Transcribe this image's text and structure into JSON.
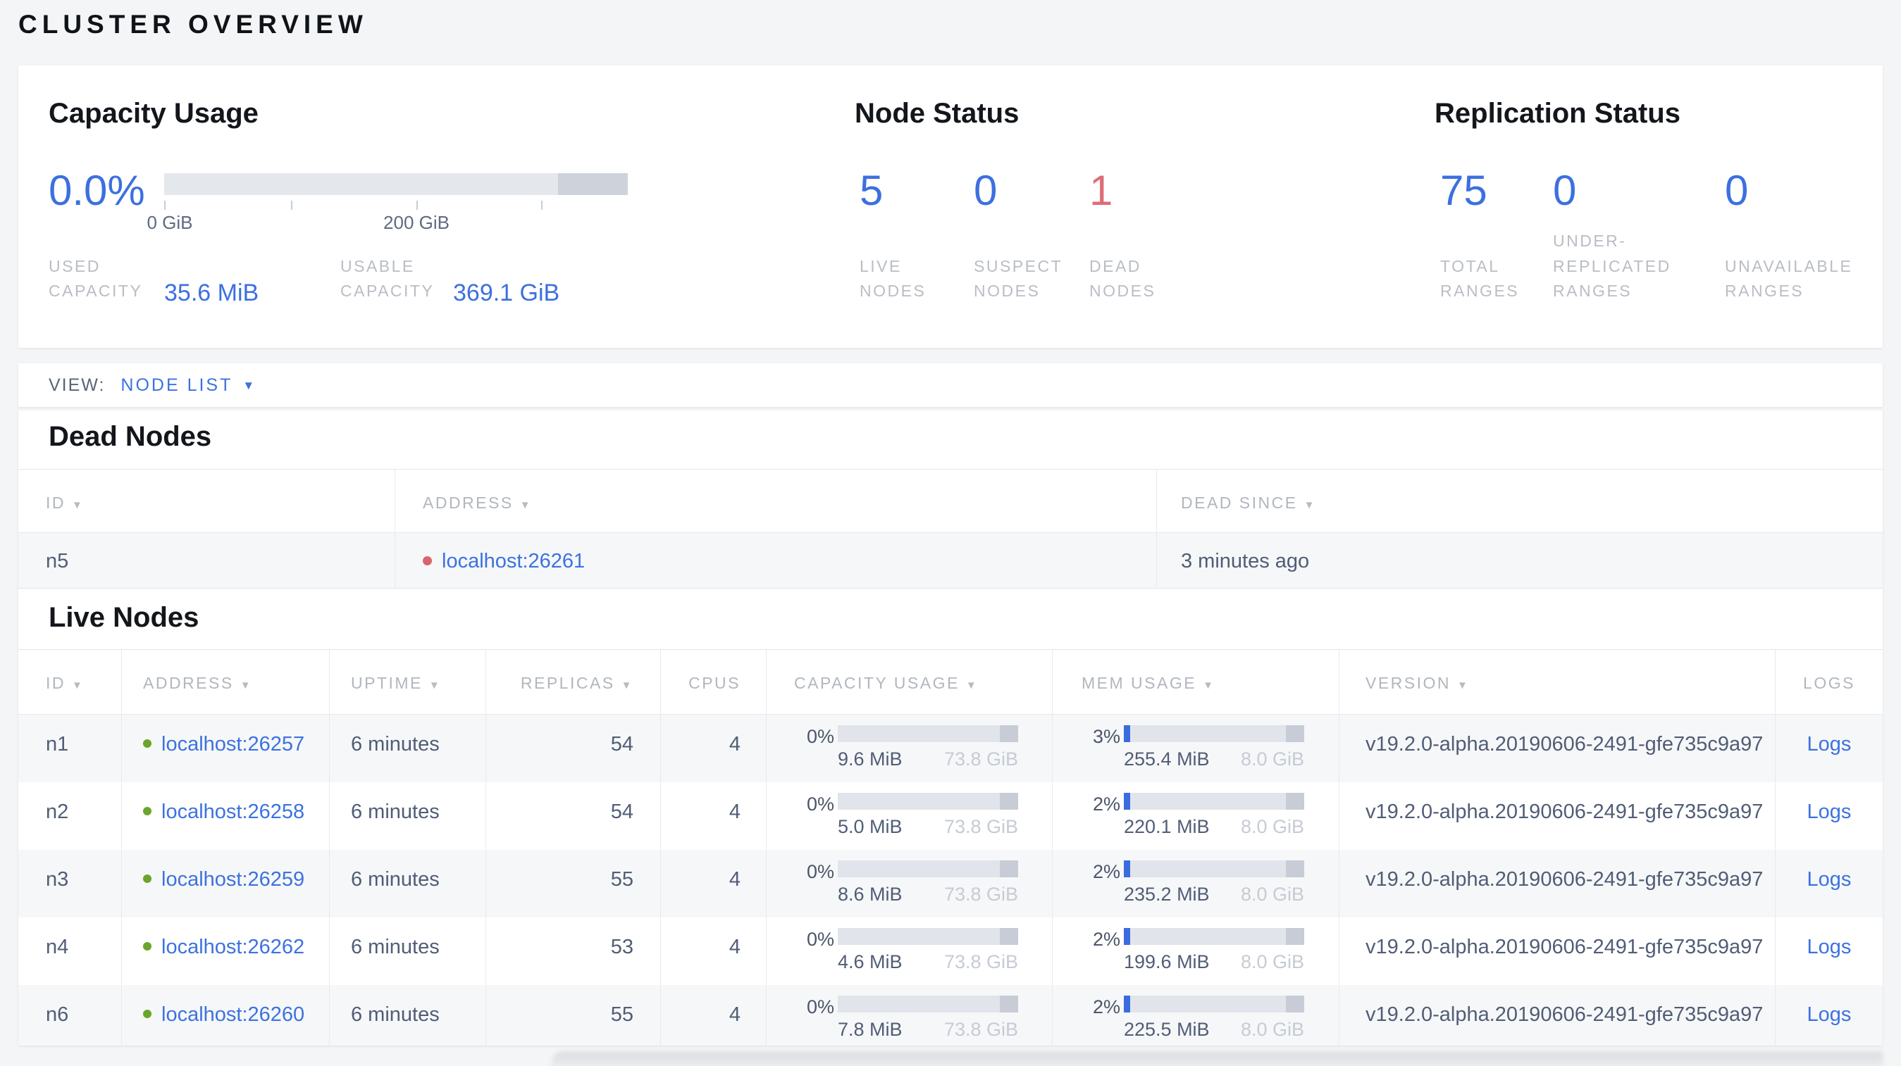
{
  "page_title": "CLUSTER OVERVIEW",
  "colors": {
    "accent_blue": "#3c70e0",
    "alert_red": "#de6d77",
    "dead_dot_red": "#d9646f",
    "live_dot_green": "#6ba52c",
    "label_grey": "#b9bdc4",
    "value_slate": "#515d76"
  },
  "summary": {
    "capacity": {
      "title": "Capacity Usage",
      "percent": "0.0%",
      "tick_labels": [
        "0 GiB",
        "200 GiB"
      ],
      "used_label": "USED CAPACITY",
      "used_value": "35.6 MiB",
      "usable_label": "USABLE CAPACITY",
      "usable_value": "369.1 GiB"
    },
    "node_status": {
      "title": "Node Status",
      "stats": [
        {
          "value": "5",
          "label": "LIVE NODES",
          "tone": "blue"
        },
        {
          "value": "0",
          "label": "SUSPECT NODES",
          "tone": "blue"
        },
        {
          "value": "1",
          "label": "DEAD NODES",
          "tone": "red"
        }
      ]
    },
    "replication": {
      "title": "Replication Status",
      "stats": [
        {
          "value": "75",
          "label": "TOTAL RANGES",
          "tone": "blue"
        },
        {
          "value": "0",
          "label": "UNDER-REPLICATED RANGES",
          "tone": "blue"
        },
        {
          "value": "0",
          "label": "UNAVAILABLE RANGES",
          "tone": "blue"
        }
      ]
    }
  },
  "view_bar": {
    "label": "VIEW:",
    "selected": "NODE LIST"
  },
  "dead_nodes": {
    "title": "Dead Nodes",
    "columns": [
      {
        "label": "ID",
        "sortable": true
      },
      {
        "label": "ADDRESS",
        "sortable": true
      },
      {
        "label": "DEAD SINCE",
        "sortable": true
      }
    ],
    "rows": [
      {
        "id": "n5",
        "address": "localhost:26261",
        "dead_since": "3 minutes ago"
      }
    ]
  },
  "live_nodes": {
    "title": "Live Nodes",
    "columns": [
      {
        "label": "ID",
        "sortable": true
      },
      {
        "label": "ADDRESS",
        "sortable": true
      },
      {
        "label": "UPTIME",
        "sortable": true
      },
      {
        "label": "REPLICAS",
        "sortable": true
      },
      {
        "label": "CPUS",
        "sortable": false
      },
      {
        "label": "CAPACITY USAGE",
        "sortable": true
      },
      {
        "label": "MEM USAGE",
        "sortable": true
      },
      {
        "label": "VERSION",
        "sortable": true
      },
      {
        "label": "LOGS",
        "sortable": false
      }
    ],
    "rows": [
      {
        "id": "n1",
        "address": "localhost:26257",
        "uptime": "6 minutes",
        "replicas": "54",
        "cpus": "4",
        "capacity_pct": "0%",
        "capacity_used": "9.6 MiB",
        "capacity_max": "73.8 GiB",
        "mem_pct": "3%",
        "mem_used": "255.4 MiB",
        "mem_max": "8.0 GiB",
        "version": "v19.2.0-alpha.20190606-2491-gfe735c9a97",
        "logs": "Logs"
      },
      {
        "id": "n2",
        "address": "localhost:26258",
        "uptime": "6 minutes",
        "replicas": "54",
        "cpus": "4",
        "capacity_pct": "0%",
        "capacity_used": "5.0 MiB",
        "capacity_max": "73.8 GiB",
        "mem_pct": "2%",
        "mem_used": "220.1 MiB",
        "mem_max": "8.0 GiB",
        "version": "v19.2.0-alpha.20190606-2491-gfe735c9a97",
        "logs": "Logs"
      },
      {
        "id": "n3",
        "address": "localhost:26259",
        "uptime": "6 minutes",
        "replicas": "55",
        "cpus": "4",
        "capacity_pct": "0%",
        "capacity_used": "8.6 MiB",
        "capacity_max": "73.8 GiB",
        "mem_pct": "2%",
        "mem_used": "235.2 MiB",
        "mem_max": "8.0 GiB",
        "version": "v19.2.0-alpha.20190606-2491-gfe735c9a97",
        "logs": "Logs"
      },
      {
        "id": "n4",
        "address": "localhost:26262",
        "uptime": "6 minutes",
        "replicas": "53",
        "cpus": "4",
        "capacity_pct": "0%",
        "capacity_used": "4.6 MiB",
        "capacity_max": "73.8 GiB",
        "mem_pct": "2%",
        "mem_used": "199.6 MiB",
        "mem_max": "8.0 GiB",
        "version": "v19.2.0-alpha.20190606-2491-gfe735c9a97",
        "logs": "Logs"
      },
      {
        "id": "n6",
        "address": "localhost:26260",
        "uptime": "6 minutes",
        "replicas": "55",
        "cpus": "4",
        "capacity_pct": "0%",
        "capacity_used": "7.8 MiB",
        "capacity_max": "73.8 GiB",
        "mem_pct": "2%",
        "mem_used": "225.5 MiB",
        "mem_max": "8.0 GiB",
        "version": "v19.2.0-alpha.20190606-2491-gfe735c9a97",
        "logs": "Logs"
      }
    ]
  }
}
